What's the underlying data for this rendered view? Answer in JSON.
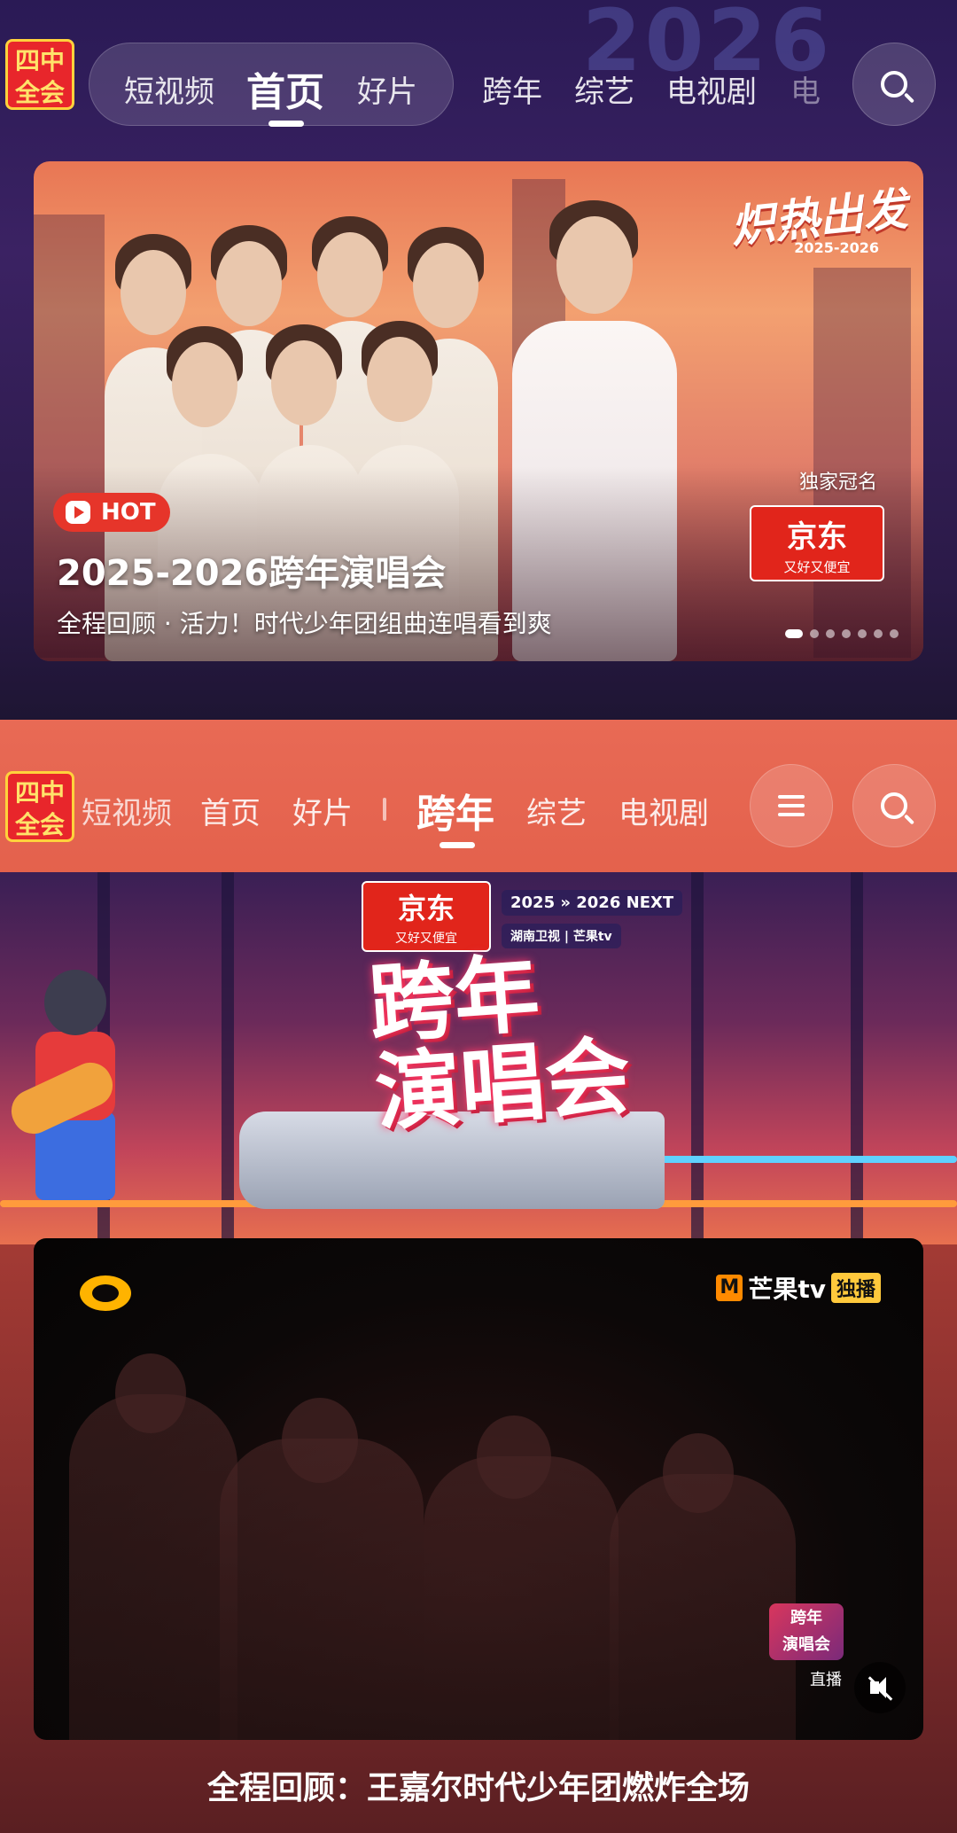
{
  "brand": {
    "logo_line1": "四中",
    "logo_line2": "全会"
  },
  "top_nav": {
    "pill_tabs": [
      "短视频",
      "首页",
      "好片"
    ],
    "active_index": 1,
    "other_tabs": [
      "跨年",
      "综艺",
      "电视剧",
      "电"
    ]
  },
  "banner": {
    "badge": "HOT",
    "title": "2025-2026跨年演唱会",
    "subtitle": "全程回顾 · 活力！时代少年团组曲连唱看到爽",
    "slogan": "炽热出发",
    "slogan_years": "2025-2026",
    "sponsor_label": "独家冠名",
    "sponsor_name": "京东",
    "sponsor_tagline": "又好又便宜",
    "dot_count": 7,
    "active_dot": 0
  },
  "sticky_nav": {
    "tabs_before": [
      "短视频",
      "首页",
      "好片"
    ],
    "active_tab": "跨年",
    "tabs_after": [
      "综艺",
      "电视剧"
    ]
  },
  "hero": {
    "sponsor_name": "京东",
    "sponsor_tagline": "又好又便宜",
    "years": "2025 » 2026 NEXT",
    "broadcaster": "湖南卫视 | 芒果tv",
    "event_line1": "跨年",
    "event_line2": "演唱会"
  },
  "video": {
    "platform": "芒果tv",
    "platform_badge": "独播",
    "live_label": "直播",
    "mini_logo_line1": "跨年",
    "mini_logo_line2": "演唱会"
  },
  "caption": "全程回顾：王嘉尔时代少年团燃炸全场",
  "colors": {
    "sticky_bg": "#e86a55",
    "hot": "#e6352a",
    "jd_red": "#e1251b",
    "mango_orange": "#ff8a00"
  }
}
